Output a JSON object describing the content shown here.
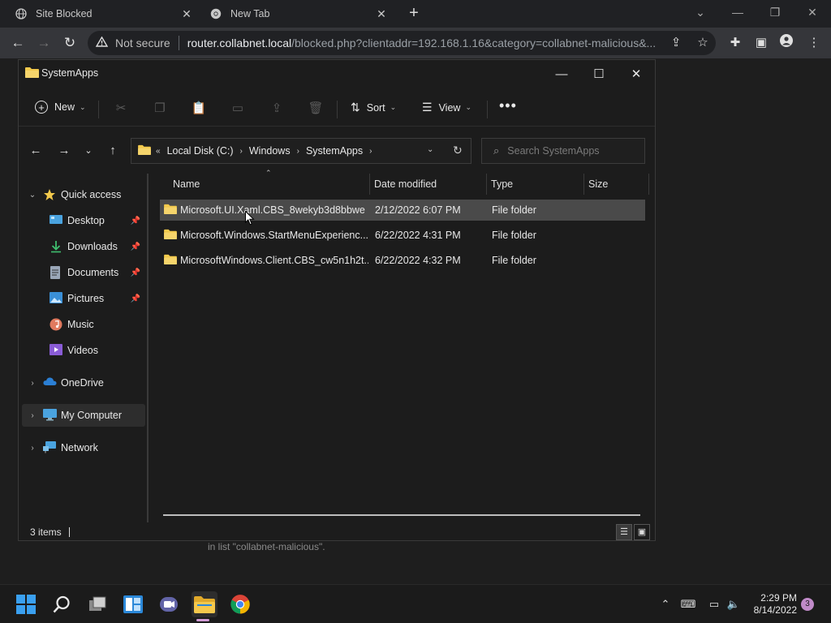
{
  "browser": {
    "tabs": [
      {
        "label": "Site Blocked",
        "icon": "globe-icon"
      },
      {
        "label": "New Tab",
        "icon": "chrome-icon"
      }
    ],
    "security_label": "Not secure",
    "url_host": "router.collabnet.local",
    "url_path": "/blocked.php?clientaddr=192.168.1.16&category=collabnet-malicious&..."
  },
  "page": {
    "blocked_text": "in list \"collabnet-malicious\"."
  },
  "explorer": {
    "title": "SystemApps",
    "commands": {
      "new_label": "New",
      "sort_label": "Sort",
      "view_label": "View"
    },
    "breadcrumb": [
      "Local Disk (C:)",
      "Windows",
      "SystemApps"
    ],
    "search_placeholder": "Search SystemApps",
    "sidebar": {
      "quick_access": "Quick access",
      "items": [
        {
          "label": "Desktop",
          "pinned": true
        },
        {
          "label": "Downloads",
          "pinned": true
        },
        {
          "label": "Documents",
          "pinned": true
        },
        {
          "label": "Pictures",
          "pinned": true
        },
        {
          "label": "Music",
          "pinned": false
        },
        {
          "label": "Videos",
          "pinned": false
        }
      ],
      "onedrive": "OneDrive",
      "my_computer": "My Computer",
      "network": "Network"
    },
    "columns": [
      "Name",
      "Date modified",
      "Type",
      "Size"
    ],
    "rows": [
      {
        "name": "Microsoft.UI.Xaml.CBS_8wekyb3d8bbwe",
        "date": "2/12/2022 6:07 PM",
        "type": "File folder",
        "size": ""
      },
      {
        "name": "Microsoft.Windows.StartMenuExperienc...",
        "date": "6/22/2022 4:31 PM",
        "type": "File folder",
        "size": ""
      },
      {
        "name": "MicrosoftWindows.Client.CBS_cw5n1h2t...",
        "date": "6/22/2022 4:32 PM",
        "type": "File folder",
        "size": ""
      }
    ],
    "status": "3 items"
  },
  "taskbar": {
    "time": "2:29 PM",
    "date": "8/14/2022",
    "notification_count": "3"
  },
  "colors": {
    "folder": "#f2c94c",
    "selection": "#4a4a4a",
    "accent": "#0078d4"
  }
}
